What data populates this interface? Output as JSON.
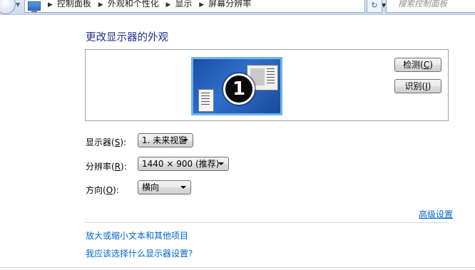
{
  "address_bar": {
    "crumbs": [
      "控制面板",
      "外观和个性化",
      "显示",
      "屏幕分辨率"
    ],
    "search_placeholder": "搜索控制面板"
  },
  "page": {
    "title": "更改显示器的外观"
  },
  "preview": {
    "monitor_number": "1",
    "detect_label": "检测",
    "detect_key": "C",
    "identify_label": "识别",
    "identify_key": "I"
  },
  "settings": {
    "display_label": "显示器",
    "display_key": "S",
    "display_value": "1. 未来视窗",
    "resolution_label": "分辨率",
    "resolution_key": "R",
    "resolution_value": "1440 × 900 (推荐)",
    "orientation_label": "方向",
    "orientation_key": "O",
    "orientation_value": "横向"
  },
  "links": {
    "advanced": "高级设置",
    "text_size": "放大或缩小文本和其他项目",
    "which_settings": "我应该选择什么显示器设置?"
  },
  "colors": {
    "title": "#1e3287",
    "link": "#0066cc",
    "monitor_selected": "#6fb4ea"
  }
}
